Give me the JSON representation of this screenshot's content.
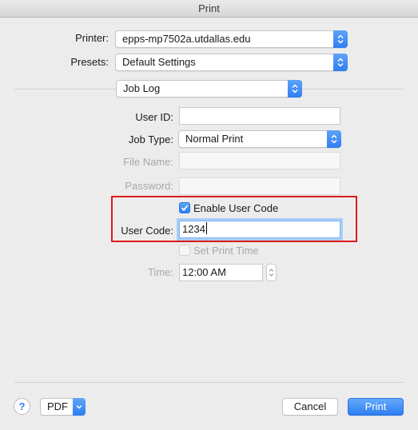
{
  "window": {
    "title": "Print"
  },
  "printer": {
    "label": "Printer:",
    "value": "epps-mp7502a.utdallas.edu"
  },
  "presets": {
    "label": "Presets:",
    "value": "Default Settings"
  },
  "section": {
    "value": "Job Log"
  },
  "fields": {
    "user_id": {
      "label": "User ID:",
      "value": ""
    },
    "job_type": {
      "label": "Job Type:",
      "value": "Normal Print"
    },
    "file_name": {
      "label": "File Name:",
      "value": ""
    },
    "password": {
      "label": "Password:",
      "value": ""
    },
    "enable_user_code": {
      "label": "Enable User Code",
      "checked": true
    },
    "user_code": {
      "label": "User Code:",
      "value": "1234"
    },
    "set_print_time": {
      "label": "Set Print Time",
      "checked": false
    },
    "time": {
      "label": "Time:",
      "value": "12:00 AM"
    }
  },
  "footer": {
    "help_label": "?",
    "pdf_label": "PDF",
    "cancel_label": "Cancel",
    "print_label": "Print"
  },
  "colors": {
    "accent": "#2f7ef2",
    "highlight": "#e0191a"
  }
}
